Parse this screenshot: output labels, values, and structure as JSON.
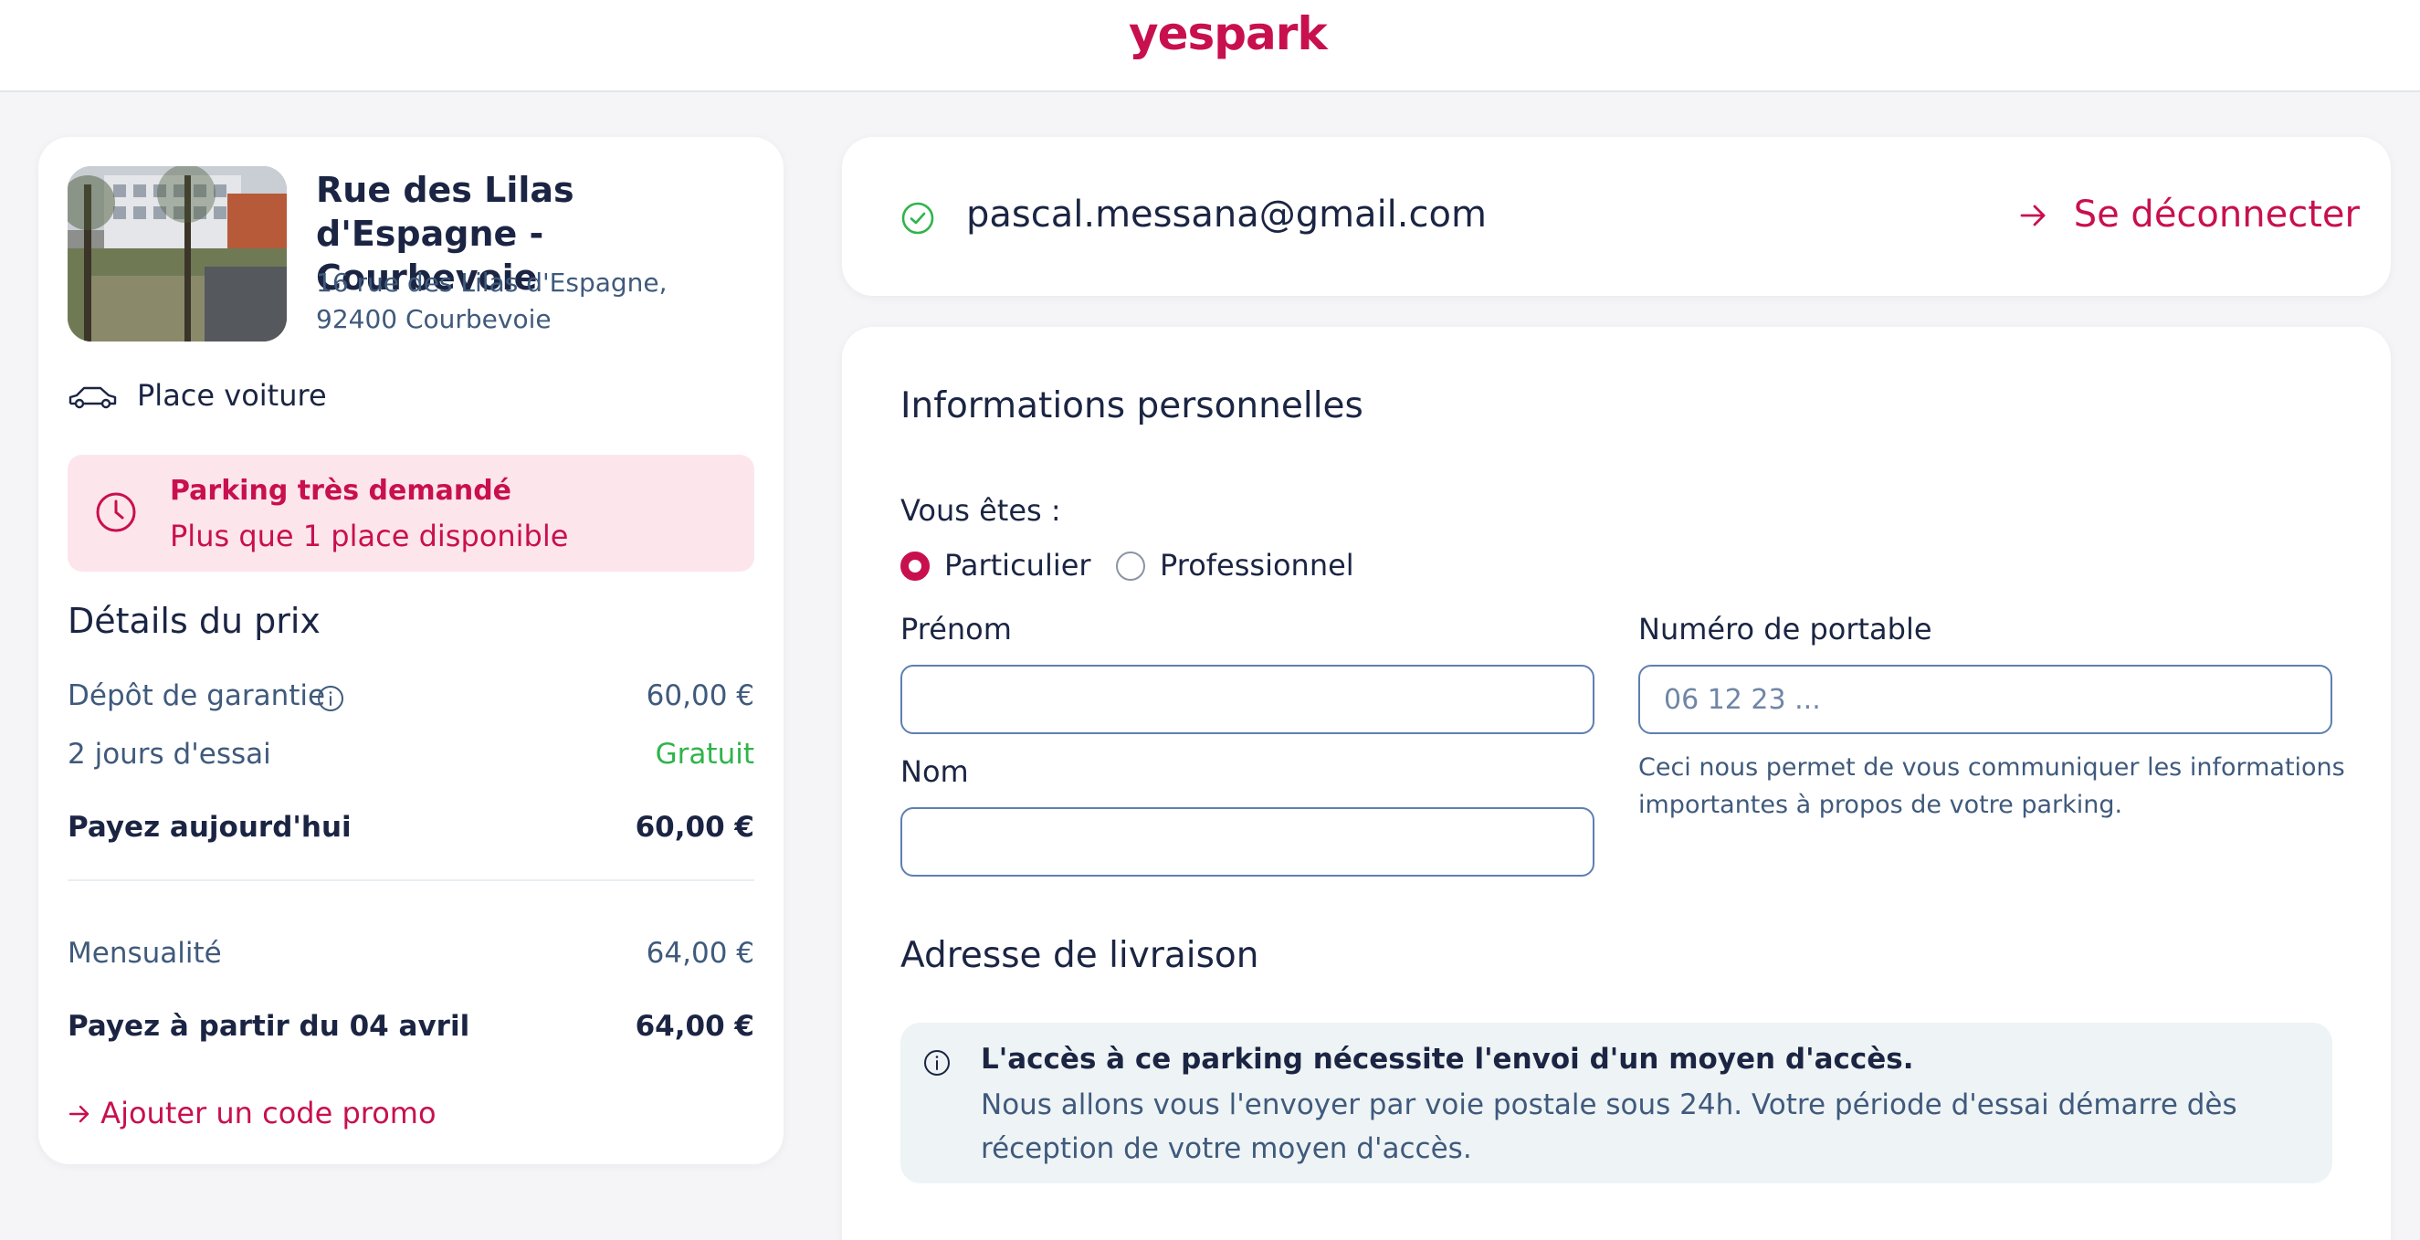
{
  "header": {
    "logo": "yespark"
  },
  "parking": {
    "title": "Rue des Lilas d'Espagne - Courbevoie",
    "address": "16 rue des Lilas d'Espagne, 92400 Courbevoie",
    "type_label": "Place voiture",
    "type_icon": "car-icon"
  },
  "alert": {
    "icon": "clock-icon",
    "title": "Parking très demandé",
    "subtitle": "Plus que 1 place disponible"
  },
  "price": {
    "heading": "Détails du prix",
    "deposit_label": "Dépôt de garantie",
    "deposit_value": "60,00 €",
    "trial_label": "2 jours d'essai",
    "trial_value": "Gratuit",
    "today_label": "Payez aujourd'hui",
    "today_value": "60,00 €",
    "monthly_label": "Mensualité",
    "monthly_value": "64,00 €",
    "from_label": "Payez à partir du 04 avril",
    "from_value": "64,00 €"
  },
  "promo_link": "Ajouter un code promo",
  "account": {
    "email": "pascal.messana@gmail.com",
    "logout_label": "Se déconnecter"
  },
  "form": {
    "section_title": "Informations personnelles",
    "you_are_label": "Vous êtes :",
    "option_individual": "Particulier",
    "option_professional": "Professionnel",
    "selected_option": "Particulier",
    "firstname_label": "Prénom",
    "firstname_value": "",
    "lastname_label": "Nom",
    "lastname_value": "",
    "phone_label": "Numéro de portable",
    "phone_placeholder": "06 12 23 ...",
    "phone_help": "Ceci nous permet de vous communiquer les informations importantes à propos de votre parking."
  },
  "delivery": {
    "section_title": "Adresse de livraison",
    "info_title": "L'accès à ce parking nécessite l'envoi d'un moyen d'accès.",
    "info_body": "Nous allons vous l'envoyer par voie postale sous 24h. Votre période d'essai démarre dès réception de votre moyen d'accès."
  },
  "colors": {
    "brand": "#c8104f",
    "success": "#2fb44a",
    "alert_bg": "#fde5ec",
    "info_bg": "#eef3f5"
  }
}
